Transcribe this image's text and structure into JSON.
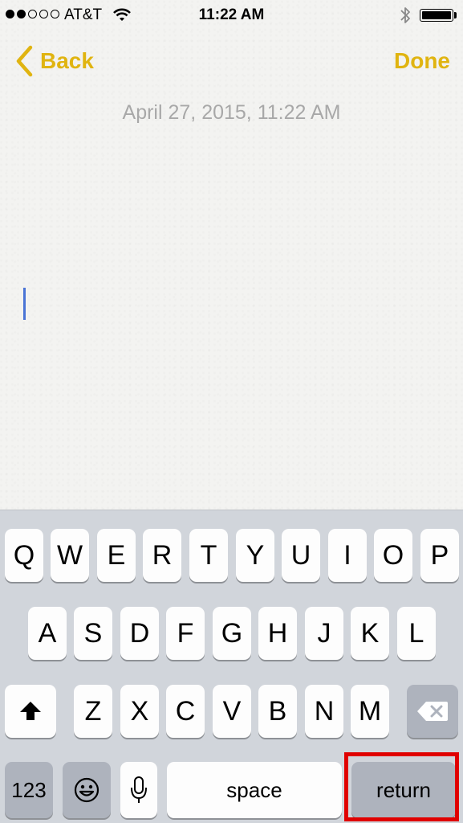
{
  "status_bar": {
    "carrier": "AT&T",
    "time": "11:22 AM",
    "signal_bars_filled": 2,
    "signal_bars_total": 5,
    "battery_level": 1.0,
    "icons": [
      "wifi-icon",
      "bluetooth-icon",
      "battery-icon"
    ]
  },
  "nav": {
    "back_label": "Back",
    "done_label": "Done",
    "accent_color": "#e0b410"
  },
  "note": {
    "date": "April 27, 2015, 11:22 AM",
    "body": ""
  },
  "keyboard": {
    "row1": [
      "Q",
      "W",
      "E",
      "R",
      "T",
      "Y",
      "U",
      "I",
      "O",
      "P"
    ],
    "row2": [
      "A",
      "S",
      "D",
      "F",
      "G",
      "H",
      "J",
      "K",
      "L"
    ],
    "row3": [
      "Z",
      "X",
      "C",
      "V",
      "B",
      "N",
      "M"
    ],
    "numbers_label": "123",
    "space_label": "space",
    "return_label": "return",
    "icons": [
      "shift-icon",
      "delete-icon",
      "emoji-icon",
      "microphone-icon"
    ],
    "highlight_color": "#e00000"
  }
}
